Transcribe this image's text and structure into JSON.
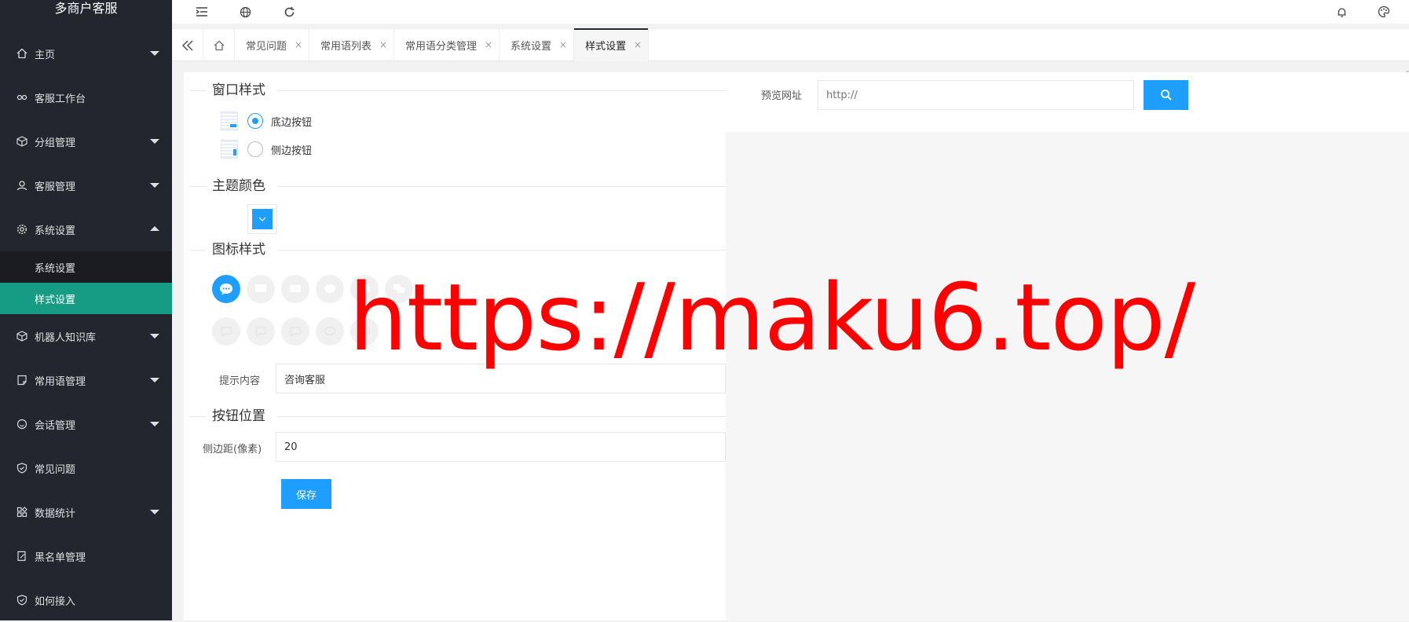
{
  "app": {
    "title": "多商户客服"
  },
  "sidebar": {
    "items": [
      {
        "label": "主页",
        "icon": "home-icon",
        "caret": "down"
      },
      {
        "label": "客服工作台",
        "icon": "link-icon",
        "caret": ""
      },
      {
        "label": "分组管理",
        "icon": "cube-icon",
        "caret": "down"
      },
      {
        "label": "客服管理",
        "icon": "user-icon",
        "caret": "down"
      },
      {
        "label": "系统设置",
        "icon": "gear-icon",
        "caret": "up"
      }
    ],
    "submenu": [
      {
        "label": "系统设置",
        "active": false
      },
      {
        "label": "样式设置",
        "active": true
      }
    ],
    "items2": [
      {
        "label": "机器人知识库",
        "icon": "cube-icon",
        "caret": "down"
      },
      {
        "label": "常用语管理",
        "icon": "note-icon",
        "caret": "down"
      },
      {
        "label": "会话管理",
        "icon": "smile-icon",
        "caret": "down"
      },
      {
        "label": "常见问题",
        "icon": "shield-icon",
        "caret": ""
      },
      {
        "label": "数据统计",
        "icon": "apps-icon",
        "caret": "down"
      },
      {
        "label": "黑名单管理",
        "icon": "edit-icon",
        "caret": ""
      },
      {
        "label": "如何接入",
        "icon": "shield-icon",
        "caret": ""
      }
    ]
  },
  "tabs": [
    {
      "label": "常见问题",
      "close": "×"
    },
    {
      "label": "常用语列表",
      "close": "×"
    },
    {
      "label": "常用语分类管理",
      "close": "×"
    },
    {
      "label": "系统设置",
      "close": "×"
    },
    {
      "label": "样式设置",
      "close": "×",
      "active": true
    }
  ],
  "form": {
    "window_style": {
      "legend": "窗口样式",
      "options": [
        {
          "label": "底边按钮",
          "checked": true
        },
        {
          "label": "侧边按钮",
          "checked": false
        }
      ]
    },
    "theme_color": {
      "legend": "主题颜色",
      "value": "#1e9fff"
    },
    "icon_style": {
      "legend": "图标样式",
      "selected_index": 0
    },
    "tip": {
      "label": "提示内容",
      "value": "咨询客服"
    },
    "button_position": {
      "legend": "按钮位置"
    },
    "side_margin": {
      "label": "侧边距(像素)",
      "value": "20"
    },
    "save_label": "保存"
  },
  "preview": {
    "label": "预览网址",
    "placeholder": "http://"
  },
  "watermark": "https://maku6.top/",
  "colors": {
    "accent": "#1e9fff",
    "sidebar_bg": "#23262e",
    "active_teal": "#169c84",
    "watermark": "#ff0000"
  }
}
